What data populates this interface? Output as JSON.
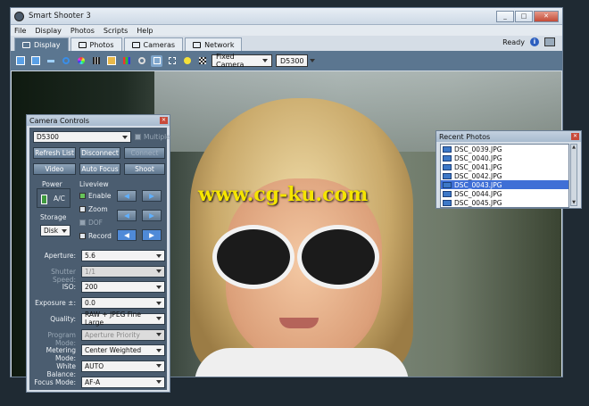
{
  "window": {
    "title": "Smart Shooter 3",
    "controls": [
      "_",
      "□",
      "✕"
    ]
  },
  "menu": [
    "File",
    "Display",
    "Photos",
    "Scripts",
    "Help"
  ],
  "tabs": [
    {
      "label": "Display",
      "active": true
    },
    {
      "label": "Photos",
      "active": false
    },
    {
      "label": "Cameras",
      "active": false
    },
    {
      "label": "Network",
      "active": false
    }
  ],
  "status": {
    "ready": "Ready",
    "info_glyph": "i"
  },
  "toolbar": {
    "icons": [
      "grid-one-icon",
      "grid-two-icon",
      "link-icon",
      "refresh-icon",
      "color-wheel-icon",
      "grid-icon",
      "image-tag-icon",
      "histogram-icon",
      "zoom-icon",
      "focus-icon",
      "zoom-area-icon",
      "lightbulb-icon",
      "checker-icon"
    ],
    "mode_select": "Fixed Camera",
    "camera_select": "D5300"
  },
  "camera_controls": {
    "title": "Camera Controls",
    "camera": "D5300",
    "multiple_label": "Multiple",
    "buttons": {
      "refresh": "Refresh List",
      "disconnect": "Disconnect",
      "connect": "Connect",
      "video": "Video",
      "autofocus": "Auto Focus",
      "shoot": "Shoot"
    },
    "power_label": "Power",
    "power_value": "A/C",
    "storage_label": "Storage",
    "storage_value": "Disk",
    "liveview_label": "Liveview",
    "liveview_options": [
      {
        "label": "Enable",
        "checked": true,
        "disabled": false
      },
      {
        "label": "Zoom",
        "checked": false,
        "disabled": false
      },
      {
        "label": "DOF",
        "checked": false,
        "disabled": true
      },
      {
        "label": "Record",
        "checked": false,
        "disabled": false
      }
    ],
    "settings": [
      {
        "label": "Aperture:",
        "value": "5.6",
        "disabled": false
      },
      {
        "label": "Shutter Speed:",
        "value": "1/1",
        "disabled": true
      },
      {
        "label": "ISO:",
        "value": "200",
        "disabled": false
      },
      {
        "label": "Exposure ±:",
        "value": "0.0",
        "disabled": false
      },
      {
        "label": "Quality:",
        "value": "RAW + JPEG Fine Large",
        "disabled": false
      },
      {
        "label": "Program Mode:",
        "value": "Aperture Priority",
        "disabled": true
      },
      {
        "label": "Metering Mode:",
        "value": "Center Weighted",
        "disabled": false
      },
      {
        "label": "White Balance:",
        "value": "AUTO",
        "disabled": false
      },
      {
        "label": "Focus Mode:",
        "value": "AF-A",
        "disabled": false
      }
    ]
  },
  "recent_photos": {
    "title": "Recent Photos",
    "items": [
      {
        "name": "DSC_0039.JPG",
        "selected": false
      },
      {
        "name": "DSC_0040.JPG",
        "selected": false
      },
      {
        "name": "DSC_0041.JPG",
        "selected": false
      },
      {
        "name": "DSC_0042.JPG",
        "selected": false
      },
      {
        "name": "DSC_0043.JPG",
        "selected": true
      },
      {
        "name": "DSC_0044.JPG",
        "selected": false
      },
      {
        "name": "DSC_0045.JPG",
        "selected": false
      }
    ]
  },
  "watermark": "www.cg-ku.com",
  "colors": {
    "accent": "#5b7690",
    "selection": "#3f6fd6",
    "close": "#c84a3a"
  }
}
